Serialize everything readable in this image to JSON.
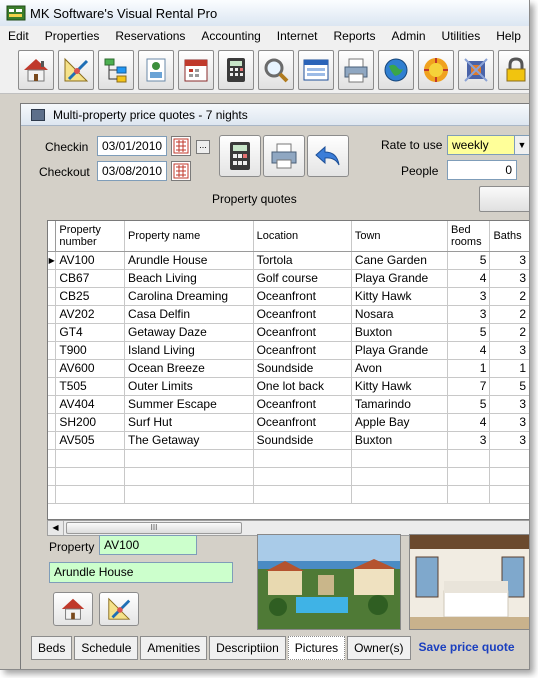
{
  "app": {
    "title": "MK Software's Visual Rental Pro"
  },
  "menu": [
    "Edit",
    "Properties",
    "Reservations",
    "Accounting",
    "Internet",
    "Reports",
    "Admin",
    "Utilities",
    "Help"
  ],
  "window": {
    "title": "Multi-property price quotes - 7 nights"
  },
  "form": {
    "checkin_label": "Checkin",
    "checkin_value": "03/01/2010",
    "checkout_label": "Checkout",
    "checkout_value": "03/08/2010",
    "ellipsis": "...",
    "rate_label": "Rate to use",
    "rate_value": "weekly",
    "people_label": "People",
    "people_value": "0",
    "quotes_label": "Property quotes"
  },
  "grid": {
    "columns": [
      "Property number",
      "Property name",
      "Location",
      "Town",
      "Bed rooms",
      "Baths"
    ],
    "rows": [
      [
        "AV100",
        "Arundle House",
        "Tortola",
        "Cane Garden",
        "5",
        "3"
      ],
      [
        "CB67",
        "Beach Living",
        "Golf course",
        "Playa Grande",
        "4",
        "3"
      ],
      [
        "CB25",
        "Carolina Dreaming",
        "Oceanfront",
        "Kitty Hawk",
        "3",
        "2"
      ],
      [
        "AV202",
        "Casa Delfin",
        "Oceanfront",
        "Nosara",
        "3",
        "2"
      ],
      [
        "GT4",
        "Getaway Daze",
        "Oceanfront",
        "Buxton",
        "5",
        "2"
      ],
      [
        "T900",
        "Island Living",
        "Oceanfront",
        "Playa Grande",
        "4",
        "3"
      ],
      [
        "AV600",
        "Ocean Breeze",
        "Soundside",
        "Avon",
        "1",
        "1"
      ],
      [
        "T505",
        "Outer Limits",
        "One lot back",
        "Kitty Hawk",
        "7",
        "5"
      ],
      [
        "AV404",
        "Summer Escape",
        "Oceanfront",
        "Tamarindo",
        "5",
        "3"
      ],
      [
        "SH200",
        "Surf Hut",
        "Oceanfront",
        "Apple Bay",
        "4",
        "3"
      ],
      [
        "AV505",
        "The Getaway",
        "Soundside",
        "Buxton",
        "3",
        "3"
      ]
    ],
    "scroll_grip": "III"
  },
  "details": {
    "property_label": "Property",
    "property_value": "AV100",
    "property_name": "Arundle House"
  },
  "tabs": [
    "Beds",
    "Schedule",
    "Amenities",
    "Descriptiion",
    "Pictures",
    "Owner(s)"
  ],
  "save_link": "Save price quote",
  "colors": {
    "rate_field": "#ffff99",
    "green_field": "#ccffcc",
    "link": "#1a3fbf"
  }
}
